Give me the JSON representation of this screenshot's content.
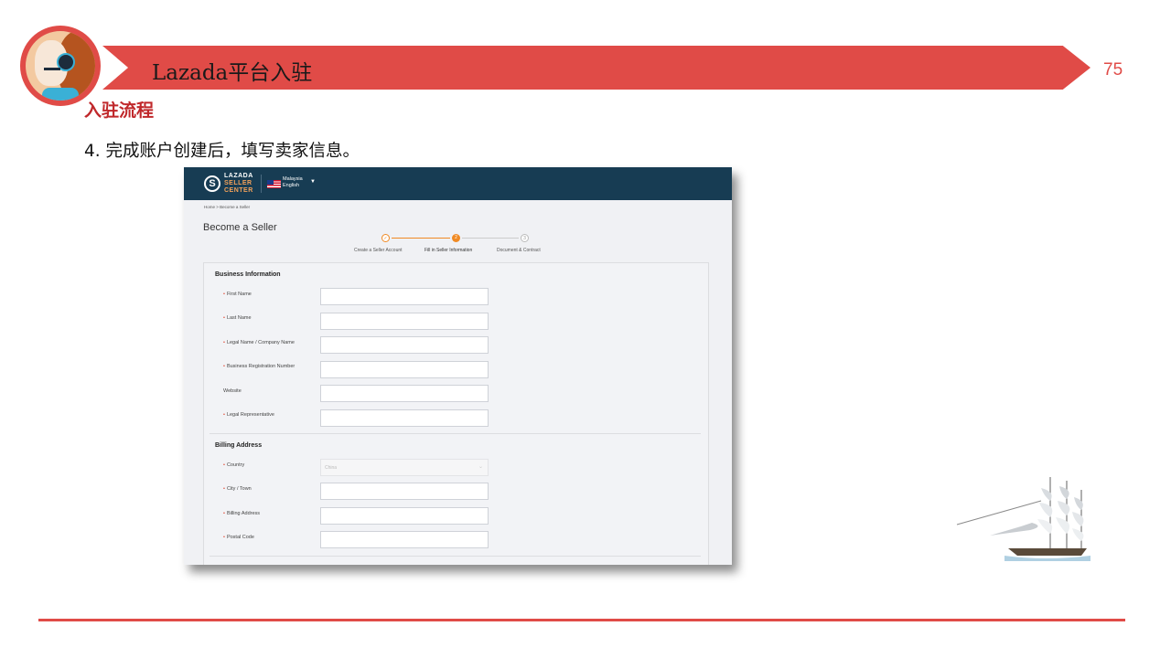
{
  "header": {
    "title": "Lazada平台入驻",
    "page_number": "75"
  },
  "section_heading": "入驻流程",
  "step_text": "4. 完成账户创建后，填写卖家信息。",
  "screenshot": {
    "logo": {
      "line1": "LAZADA",
      "line2": "SELLER",
      "line3": "CENTER",
      "icon": "S"
    },
    "country": {
      "name": "Malaysia",
      "language": "English"
    },
    "breadcrumb": "Home  >  Become a Seller",
    "page_title": "Become a Seller",
    "steps": [
      {
        "label": "Create a Seller Account",
        "marker": "✓",
        "state": "done"
      },
      {
        "label": "Fill in Seller Information",
        "marker": "2",
        "state": "active"
      },
      {
        "label": "Document & Contract",
        "marker": "3",
        "state": "pending"
      }
    ],
    "business_section": "Business Information",
    "business_fields": [
      {
        "label": "First Name",
        "required": true
      },
      {
        "label": "Last Name",
        "required": true
      },
      {
        "label": "Legal Name / Company Name",
        "required": true
      },
      {
        "label": "Business Registration Number",
        "required": true
      },
      {
        "label": "Website",
        "required": false
      },
      {
        "label": "Legal Representative",
        "required": true
      }
    ],
    "billing_section": "Billing Address",
    "billing_fields": [
      {
        "label": "Country",
        "required": true,
        "value": "China"
      },
      {
        "label": "City / Town",
        "required": true
      },
      {
        "label": "Billing Address",
        "required": true
      },
      {
        "label": "Postal Code",
        "required": true
      }
    ],
    "required_marker": "•"
  },
  "colors": {
    "accent": "#e04b47",
    "heading_red": "#c0282b",
    "lazada_navy": "#173c53",
    "step_orange": "#f08a24"
  }
}
